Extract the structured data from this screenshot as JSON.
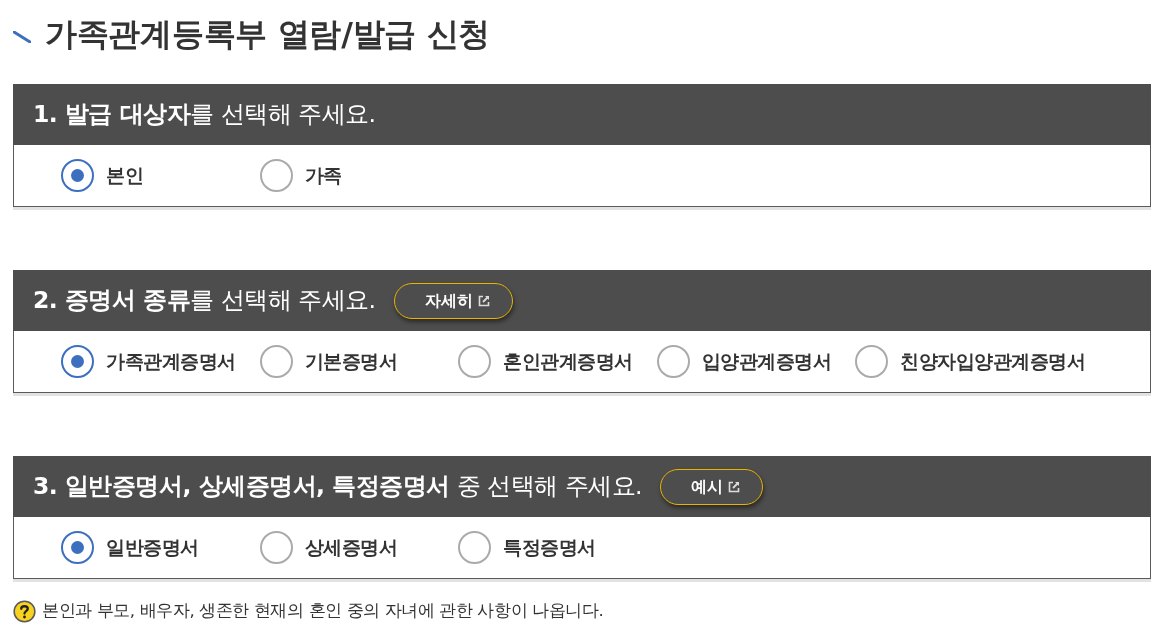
{
  "title": "가족관계등록부 열람/발급 신청",
  "sections": [
    {
      "heading": "**1. 발급 대상자**를 선택해 주세요.",
      "options": [
        {
          "label": "본인",
          "selected": true
        },
        {
          "label": "가족",
          "selected": false
        }
      ]
    },
    {
      "heading": "**2. 증명서 종류**를 선택해 주세요.",
      "button": "자세히",
      "options": [
        {
          "label": "가족관계증명서",
          "selected": true
        },
        {
          "label": "기본증명서",
          "selected": false
        },
        {
          "label": "혼인관계증명서",
          "selected": false
        },
        {
          "label": "입양관계증명서",
          "selected": false
        },
        {
          "label": "친양자입양관계증명서",
          "selected": false
        }
      ]
    },
    {
      "heading": "**3. 일반증명서, 상세증명서, 특정증명서** 중 선택해 주세요.",
      "button": "예시",
      "options": [
        {
          "label": "일반증명서",
          "selected": true
        },
        {
          "label": "상세증명서",
          "selected": false
        },
        {
          "label": "특정증명서",
          "selected": false
        }
      ]
    }
  ],
  "help": "본인과 부모, 배우자, 생존한 현재의 혼인 중의 자녀에 관한 사항이 나옵니다."
}
